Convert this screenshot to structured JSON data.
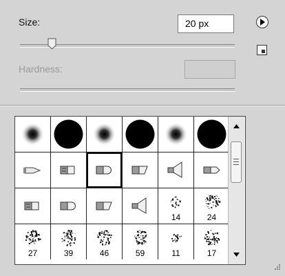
{
  "size": {
    "label": "Size:",
    "value": "20 px",
    "slider_fraction": 0.15
  },
  "hardness": {
    "label": "Hardness:",
    "value": ""
  },
  "buttons": {
    "flyout": "flyout-menu",
    "new_preset": "new-preset"
  },
  "brushes": [
    {
      "kind": "soft",
      "number": ""
    },
    {
      "kind": "hard",
      "number": ""
    },
    {
      "kind": "soft",
      "number": ""
    },
    {
      "kind": "hard",
      "number": ""
    },
    {
      "kind": "soft",
      "number": ""
    },
    {
      "kind": "hard",
      "number": ""
    },
    {
      "kind": "tip-pointed",
      "number": ""
    },
    {
      "kind": "tip-flat",
      "number": ""
    },
    {
      "kind": "tip-round",
      "number": "",
      "selected": true
    },
    {
      "kind": "tip-angled",
      "number": ""
    },
    {
      "kind": "tip-fan",
      "number": ""
    },
    {
      "kind": "tip-bullet",
      "number": ""
    },
    {
      "kind": "tip-flat",
      "number": ""
    },
    {
      "kind": "tip-round",
      "number": ""
    },
    {
      "kind": "tip-angled",
      "number": ""
    },
    {
      "kind": "tip-fan",
      "number": ""
    },
    {
      "kind": "scatter-small",
      "number": "14"
    },
    {
      "kind": "scatter-large",
      "number": "24"
    },
    {
      "kind": "scatter-large",
      "number": "27"
    },
    {
      "kind": "scatter-large",
      "number": "39"
    },
    {
      "kind": "scatter-large",
      "number": "46"
    },
    {
      "kind": "scatter-large",
      "number": "59"
    },
    {
      "kind": "scatter-small",
      "number": "11"
    },
    {
      "kind": "scatter-large",
      "number": "17"
    }
  ]
}
